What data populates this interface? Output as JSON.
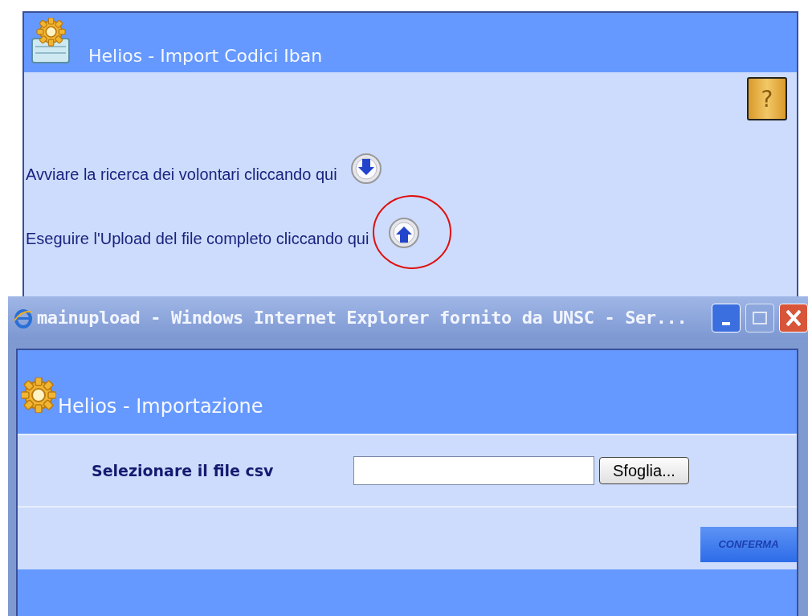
{
  "back_page": {
    "title": "Helios - Import Codici Iban",
    "help_button": "?",
    "actions": [
      {
        "text": "Avviare la ricerca dei volontari cliccando qui",
        "kind": "download",
        "highlighted": false
      },
      {
        "text": "Eseguire l'Upload del file completo cliccando qui",
        "kind": "upload",
        "highlighted": true
      }
    ]
  },
  "popup": {
    "window": {
      "title": "mainupload - Windows Internet Explorer fornito da UNSC - Ser..."
    },
    "window_controls": [
      {
        "kind": "minimize",
        "disabled": false
      },
      {
        "kind": "maximize",
        "disabled": true
      },
      {
        "kind": "close",
        "disabled": false
      }
    ],
    "page": {
      "title": "Helios - Importazione",
      "field_label": "Selezionare il file csv",
      "browse_button": "Sfoglia...",
      "confirm_button": "CONFERMA"
    }
  }
}
